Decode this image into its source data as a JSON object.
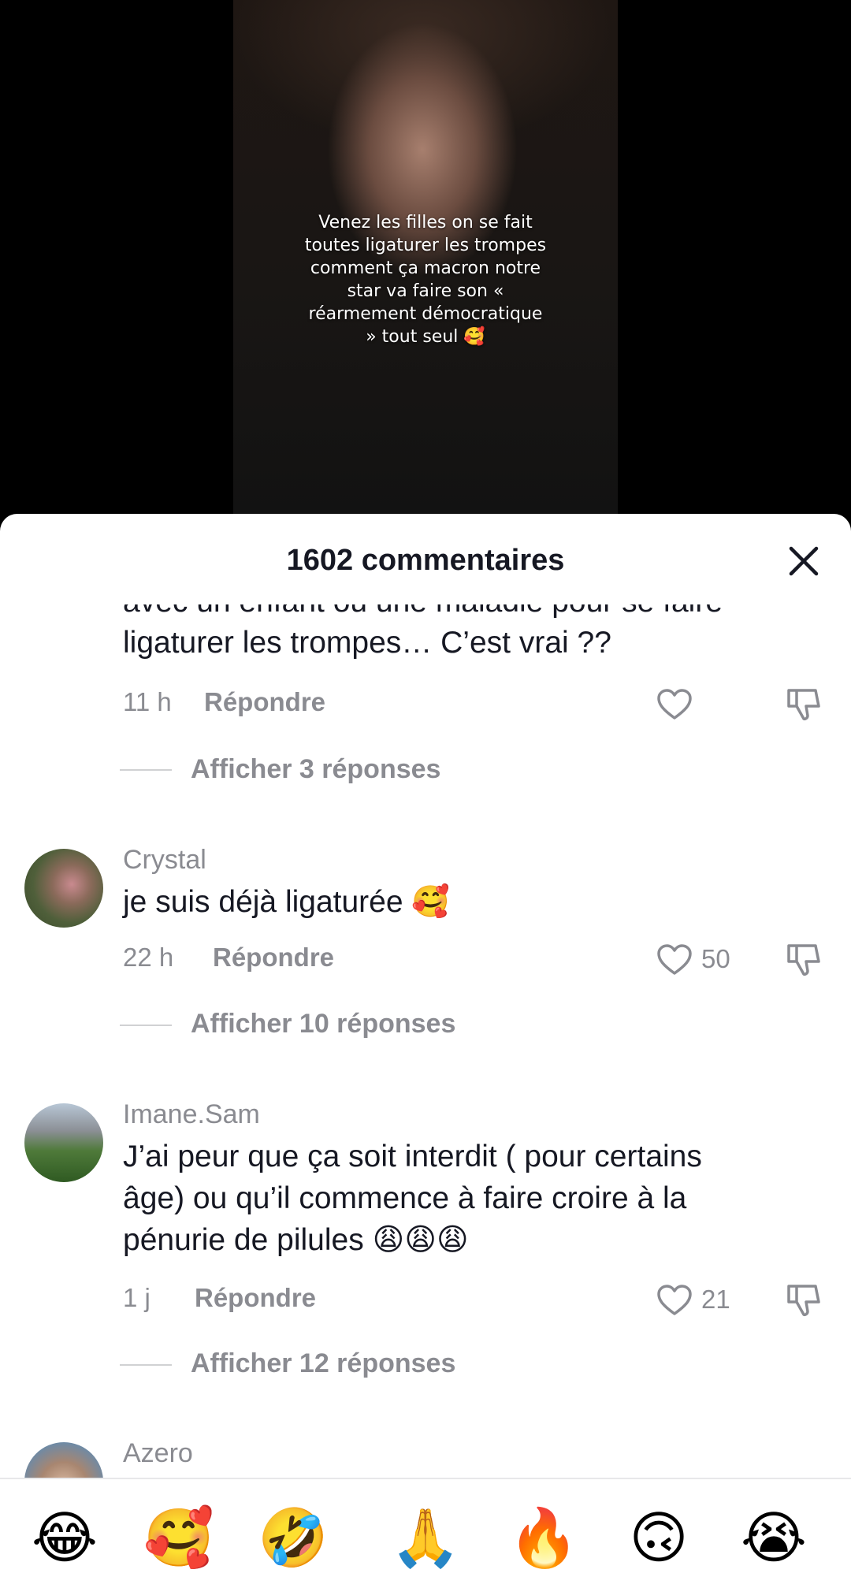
{
  "video": {
    "caption": "Venez les filles on se fait toutes ligaturer les trompes comment ça macron notre star va faire son « réarmement démocratique » tout seul 🥰"
  },
  "sheet": {
    "title": "1602 commentaires"
  },
  "comments": [
    {
      "text_partial": "avec un enfant ou une maladie pour se faire",
      "text": "ligaturer les trompes… C’est vrai ??",
      "time": "11 h",
      "reply_label": "Répondre",
      "likes": "",
      "replies_label": "Afficher 3 réponses"
    },
    {
      "username": "Crystal",
      "text": "je suis déjà ligaturée 🥰",
      "time": "22 h",
      "reply_label": "Répondre",
      "likes": "50",
      "replies_label": "Afficher 10 réponses"
    },
    {
      "username": "Imane.Sam",
      "text_lines": [
        "J’ai peur que ça soit interdit ( pour certains",
        "âge) ou qu’il commence à faire croire à la",
        "pénurie de pilules 😩😩😩"
      ],
      "time": "1 j",
      "reply_label": "Répondre",
      "likes": "21",
      "replies_label": "Afficher 12 réponses"
    },
    {
      "username": "Azero"
    }
  ],
  "emoji_bar": [
    "😂",
    "🥰",
    "🤣",
    "🙏",
    "🔥",
    "🙃",
    "😭"
  ]
}
